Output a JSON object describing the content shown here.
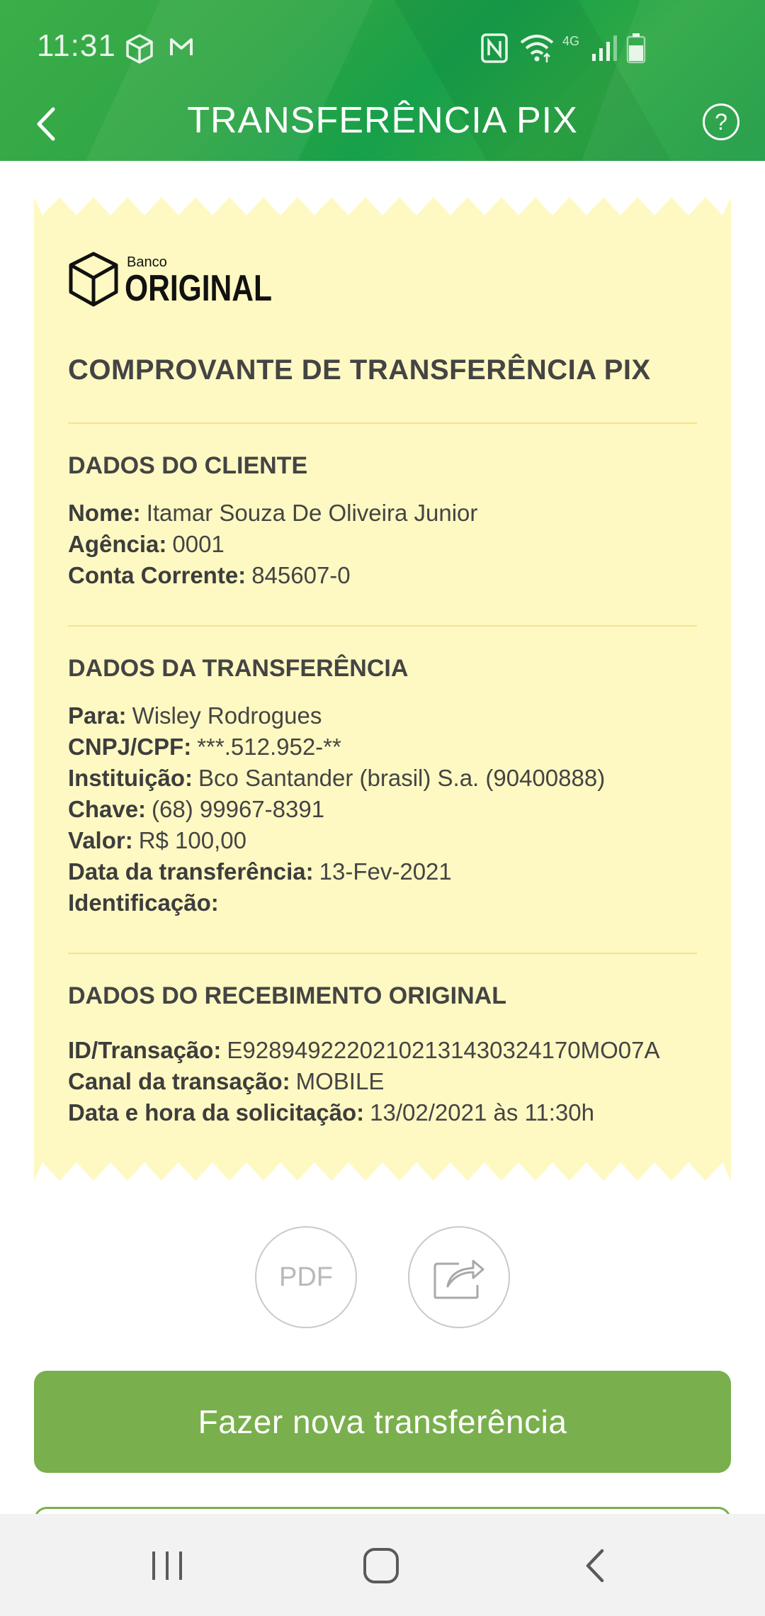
{
  "status_bar": {
    "time": "11:31",
    "network": "4G",
    "icons": [
      "box-icon",
      "gmail-icon",
      "nfc-icon",
      "wifi-icon",
      "signal-icon",
      "battery-icon"
    ]
  },
  "header": {
    "title": "TRANSFERÊNCIA PIX",
    "help_label": "?"
  },
  "receipt": {
    "logo": {
      "small": "Banco",
      "large": "ORIGINAL"
    },
    "title": "COMPROVANTE DE TRANSFERÊNCIA PIX",
    "client": {
      "heading": "DADOS DO CLIENTE",
      "fields": [
        {
          "label": "Nome:",
          "value": "Itamar Souza De Oliveira Junior"
        },
        {
          "label": "Agência:",
          "value": "0001"
        },
        {
          "label": "Conta Corrente:",
          "value": "845607-0"
        }
      ]
    },
    "transfer": {
      "heading": "DADOS DA TRANSFERÊNCIA",
      "fields": [
        {
          "label": "Para:",
          "value": "Wisley Rodrogues"
        },
        {
          "label": "CNPJ/CPF:",
          "value": "***.512.952-**"
        },
        {
          "label": "Instituição:",
          "value": "Bco Santander (brasil) S.a. (90400888)"
        },
        {
          "label": "Chave:",
          "value": "(68) 99967-8391"
        },
        {
          "label": "Valor:",
          "value": "R$ 100,00"
        },
        {
          "label": "Data da transferência:",
          "value": "13-Fev-2021"
        },
        {
          "label": "Identificação:",
          "value": ""
        }
      ]
    },
    "receipt_data": {
      "heading": "DADOS DO RECEBIMENTO ORIGINAL",
      "fields": [
        {
          "label": "ID/Transação:",
          "value": "E92894922202102131430324170MO07A"
        },
        {
          "label": "Canal da transação:",
          "value": "MOBILE"
        },
        {
          "label": "Data e hora da solicitação:",
          "value": "13/02/2021 às 11:30h"
        }
      ]
    }
  },
  "actions": {
    "pdf_label": "PDF",
    "primary_button": "Fazer nova transferência"
  },
  "colors": {
    "header_green": "#2ea544",
    "receipt_yellow": "#fef9c2",
    "button_green": "#79af4d"
  }
}
